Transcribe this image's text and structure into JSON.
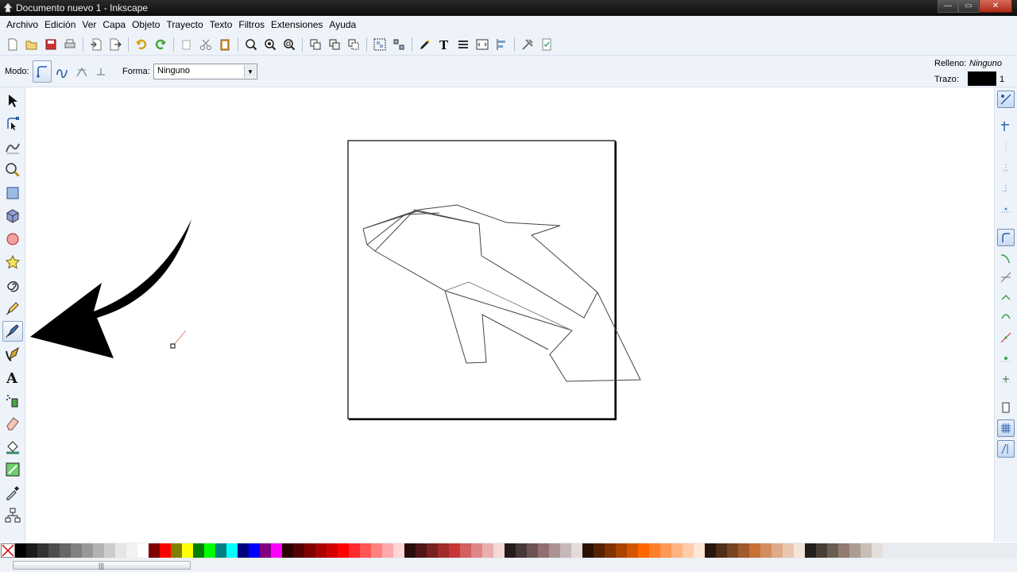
{
  "window": {
    "title": "Documento nuevo 1 - Inkscape",
    "buttons": {
      "minimize": "—",
      "maximize": "▭",
      "close": "✕"
    }
  },
  "menu": [
    "Archivo",
    "Edición",
    "Ver",
    "Capa",
    "Objeto",
    "Trayecto",
    "Texto",
    "Filtros",
    "Extensiones",
    "Ayuda"
  ],
  "toolbar": {
    "mode_label": "Modo:",
    "shape_label": "Forma:",
    "shape_value": "Ninguno"
  },
  "style": {
    "fill_label": "Relleno:",
    "fill_value": "Ninguno",
    "stroke_label": "Trazo:",
    "stroke_width": "1",
    "stroke_color": "#000000"
  },
  "active_tool": "pen-tool",
  "palette": [
    "#000000",
    "#1a1a1a",
    "#333333",
    "#4d4d4d",
    "#666666",
    "#808080",
    "#999999",
    "#b3b3b3",
    "#cccccc",
    "#e6e6e6",
    "#f2f2f2",
    "#ffffff",
    "#800000",
    "#ff0000",
    "#808000",
    "#ffff00",
    "#008000",
    "#00ff00",
    "#008080",
    "#00ffff",
    "#000080",
    "#0000ff",
    "#800080",
    "#ff00ff",
    "#2b0000",
    "#550000",
    "#800000",
    "#aa0000",
    "#d40000",
    "#ff0000",
    "#ff2a2a",
    "#ff5555",
    "#ff8080",
    "#ffaaaa",
    "#ffd5d5",
    "#280b0b",
    "#501616",
    "#782121",
    "#a02c2c",
    "#c83737",
    "#d35f5f",
    "#de8787",
    "#e9afaf",
    "#f4d7d7",
    "#241c1c",
    "#483737",
    "#6c5353",
    "#916f6f",
    "#ac9393",
    "#c8b7b7",
    "#e3dbdb",
    "#2b1100",
    "#552200",
    "#803300",
    "#aa4400",
    "#d45500",
    "#ff6600",
    "#ff7f2a",
    "#ff9955",
    "#ffb380",
    "#ffccaa",
    "#ffe6d5",
    "#28170b",
    "#502d16",
    "#784421",
    "#a05a2c",
    "#c87137",
    "#d38d5f",
    "#deaa87",
    "#e9c6af",
    "#f4e3d7",
    "#241f1c",
    "#483e37",
    "#6c5d53",
    "#917c6f",
    "#ac9d93",
    "#c8beb7",
    "#e3dedb"
  ]
}
